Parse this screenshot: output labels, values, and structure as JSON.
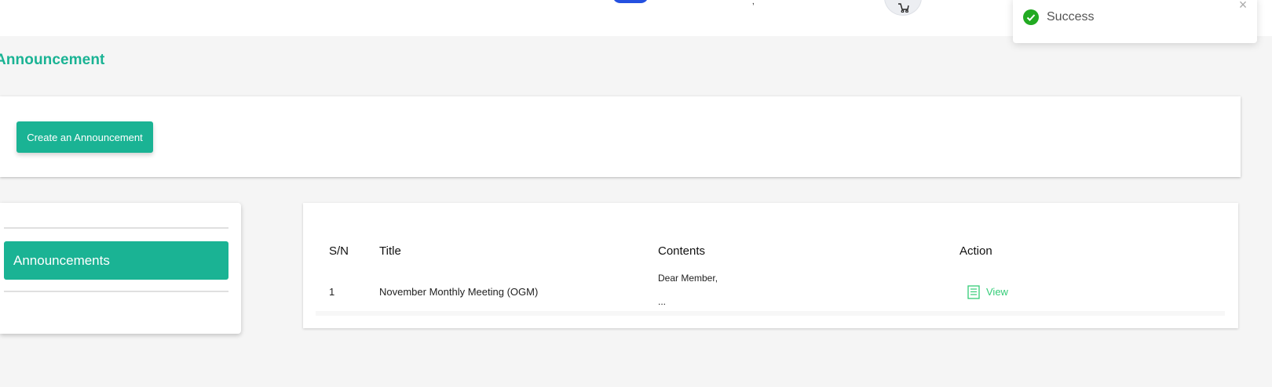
{
  "header": {
    "toggle_state": "on",
    "cart_icon": "cart-icon"
  },
  "page": {
    "title": "Announcement"
  },
  "actions": {
    "create_label": "Create an Announcement"
  },
  "sidebar": {
    "items": [
      {
        "label": "Announcements",
        "active": true
      }
    ]
  },
  "table": {
    "headers": [
      "S/N",
      "Title",
      "Contents",
      "Action"
    ],
    "rows": [
      {
        "sn": "1",
        "title": "November Monthly Meeting (OGM)",
        "contents_line1": "Dear Member,",
        "contents_line2": "...",
        "action_label": "View",
        "action_icon": "document-icon"
      }
    ]
  },
  "toast": {
    "message": "Success",
    "icon": "check-circle-icon",
    "close_glyph": "×"
  },
  "colors": {
    "accent": "#1ab394",
    "link": "#33cc77",
    "success": "#22aa22"
  }
}
